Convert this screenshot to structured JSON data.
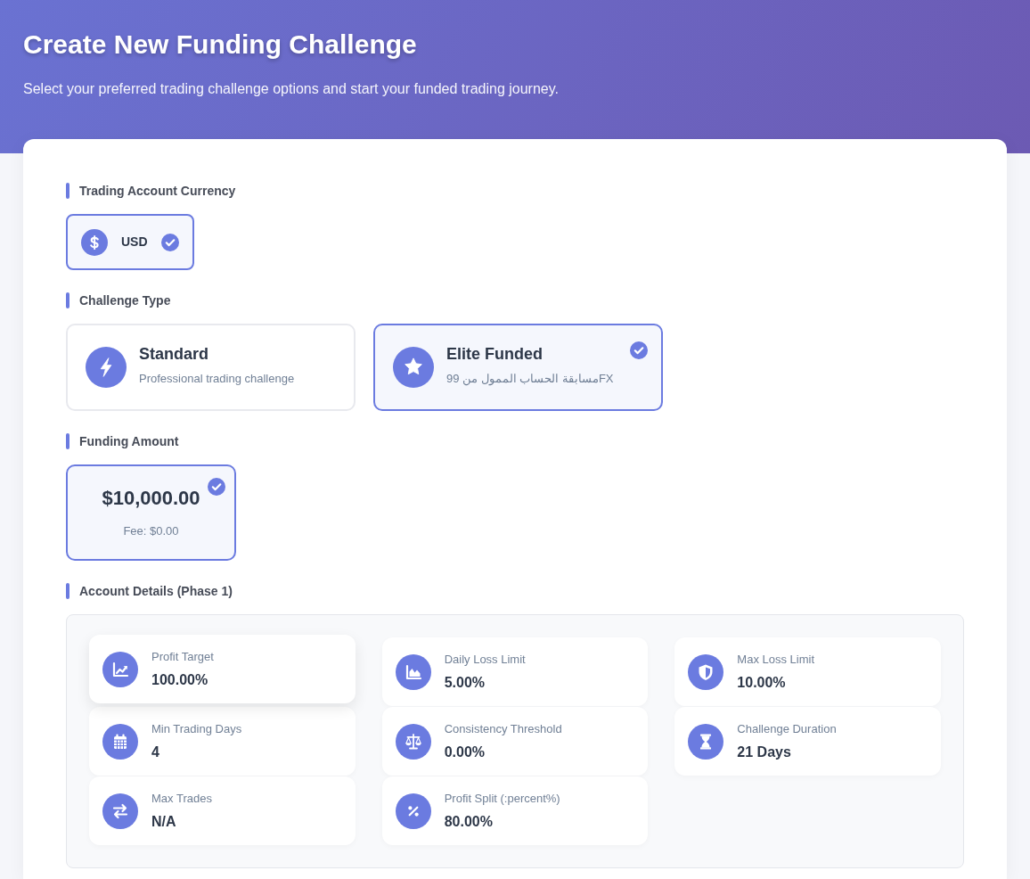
{
  "header": {
    "title": "Create New Funding Challenge",
    "subtitle": "Select your preferred trading challenge options and start your funded trading journey."
  },
  "currency_section": {
    "label": "Trading Account Currency",
    "options": [
      {
        "code": "USD",
        "selected": true
      }
    ]
  },
  "challenge_type_section": {
    "label": "Challenge Type",
    "options": [
      {
        "title": "Standard",
        "description": "Professional trading challenge",
        "selected": false
      },
      {
        "title": "Elite Funded",
        "description": "مسابقة الحساب الممول من 99FX",
        "selected": true
      }
    ]
  },
  "funding_amount_section": {
    "label": "Funding Amount",
    "options": [
      {
        "amount": "$10,000.00",
        "fee": "Fee: $0.00",
        "selected": true
      }
    ]
  },
  "account_details_section": {
    "label": "Account Details (Phase 1)",
    "items": [
      {
        "label": "Profit Target",
        "value": "100.00%",
        "hovered": true
      },
      {
        "label": "Daily Loss Limit",
        "value": "5.00%",
        "hovered": false
      },
      {
        "label": "Max Loss Limit",
        "value": "10.00%",
        "hovered": false
      },
      {
        "label": "Min Trading Days",
        "value": "4",
        "hovered": false
      },
      {
        "label": "Consistency Threshold",
        "value": "0.00%",
        "hovered": false
      },
      {
        "label": "Challenge Duration",
        "value": "21 Days",
        "hovered": false
      },
      {
        "label": "Max Trades",
        "value": "N/A",
        "hovered": false
      },
      {
        "label": "Profit Split (:percent%)",
        "value": "80.00%",
        "hovered": false
      }
    ]
  }
}
